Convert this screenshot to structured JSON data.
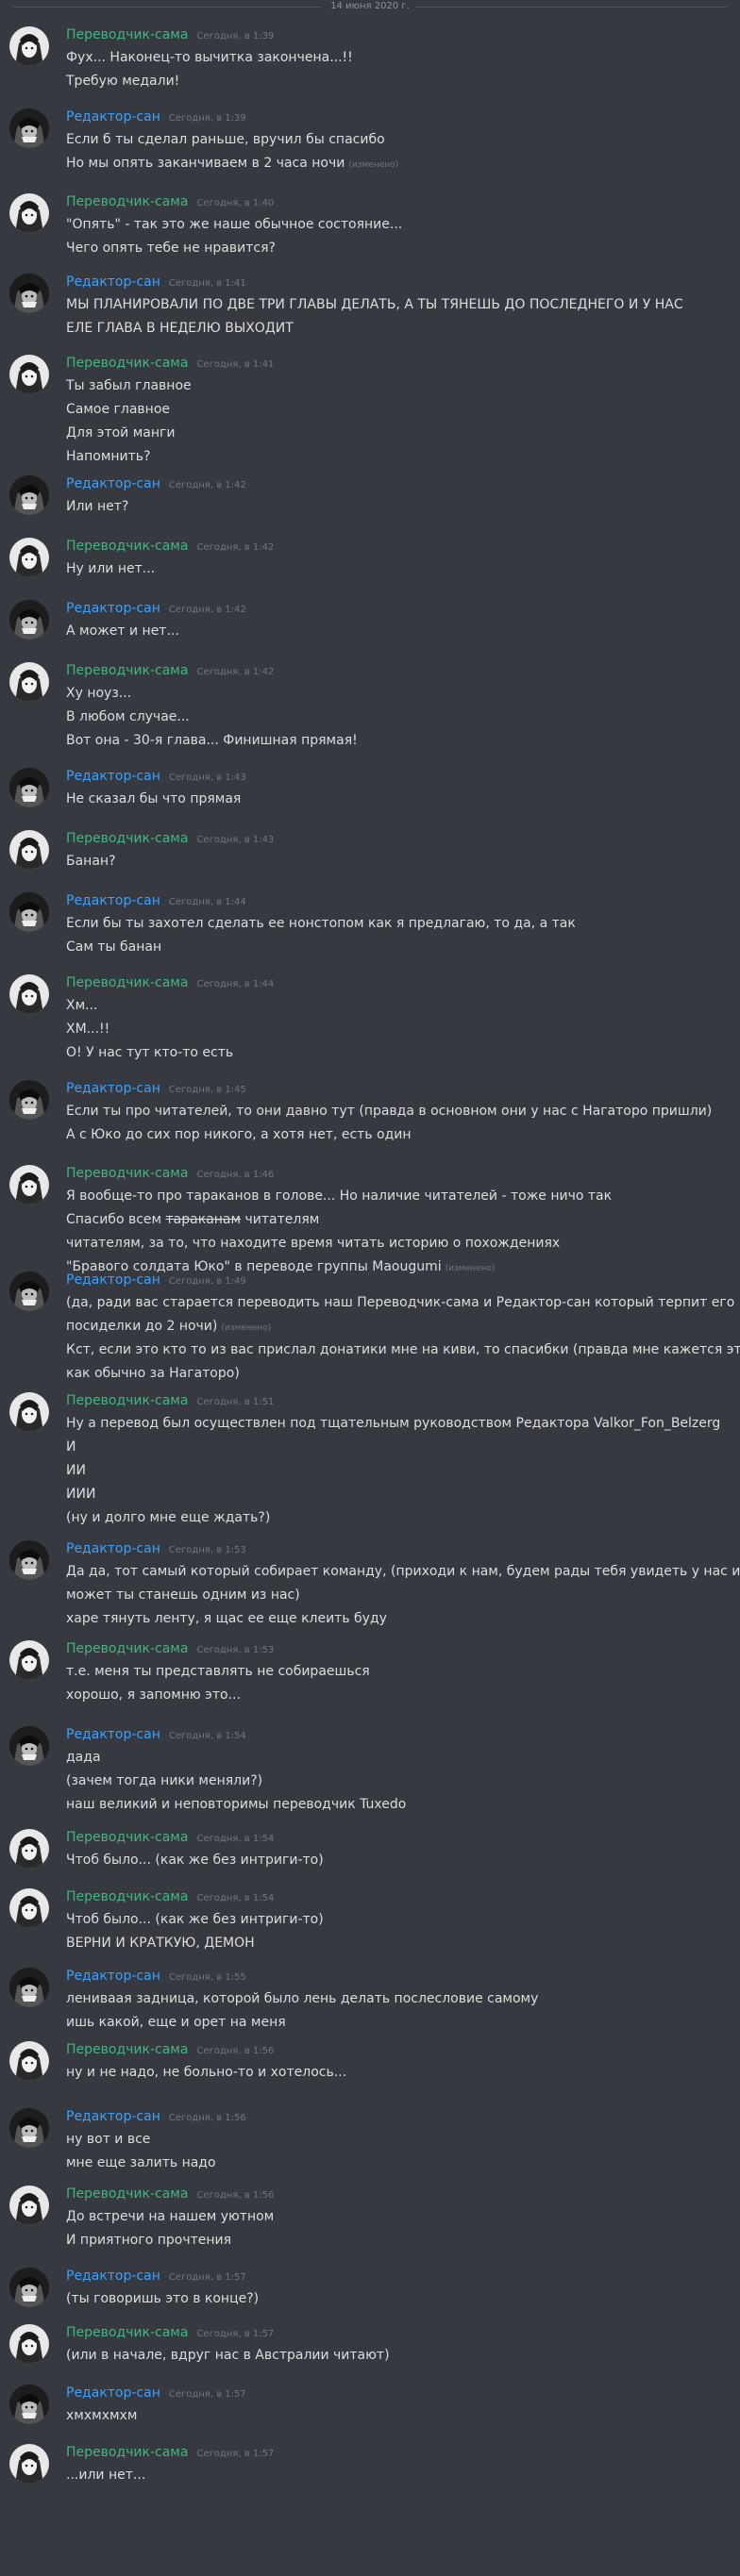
{
  "date_divider": "14 июня 2020 г.",
  "users": {
    "translator": "Переводчик-сама",
    "editor": "Редактор-сан"
  },
  "edited_label": "(изменено)",
  "messages": [
    {
      "author": "translator",
      "time": "Сегодня, в 1:39",
      "lines": [
        "Фух... Наконец-то вычитка закончена...!!",
        "Требую медали!"
      ]
    },
    {
      "author": "editor",
      "time": "Сегодня, в 1:39",
      "lines": [
        "Если б ты сделал раньше, вручил бы спасибо",
        "Но мы опять заканчиваем в 2 часа ночи"
      ],
      "edited_line": 1
    },
    {
      "author": "translator",
      "time": "Сегодня, в 1:40",
      "lines": [
        "\"Опять\" - так это же наше обычное состояние...",
        "Чего опять тебе не нравится?"
      ]
    },
    {
      "author": "editor",
      "time": "Сегодня, в 1:41",
      "lines": [
        "МЫ ПЛАНИРОВАЛИ ПО ДВЕ ТРИ ГЛАВЫ ДЕЛАТЬ, А ТЫ ТЯНЕШЬ ДО ПОСЛЕДНЕГО И У НАС",
        "ЕЛЕ ГЛАВА В НЕДЕЛЮ ВЫХОДИТ"
      ]
    },
    {
      "author": "translator",
      "time": "Сегодня, в 1:41",
      "lines": [
        "Ты забыл главное",
        "Самое главное",
        "Для этой манги",
        "Напомнить?"
      ]
    },
    {
      "author": "editor",
      "time": "Сегодня, в 1:42",
      "lines": [
        "Или нет?"
      ]
    },
    {
      "author": "translator",
      "time": "Сегодня, в 1:42",
      "lines": [
        "Ну или нет..."
      ]
    },
    {
      "author": "editor",
      "time": "Сегодня, в 1:42",
      "lines": [
        "А может и нет..."
      ]
    },
    {
      "author": "translator",
      "time": "Сегодня, в 1:42",
      "lines": [
        "Ху ноуз...",
        "В любом случае...",
        "Вот она - 30-я глава... Финишная прямая!"
      ]
    },
    {
      "author": "editor",
      "time": "Сегодня, в 1:43",
      "lines": [
        "Не сказал бы что прямая"
      ]
    },
    {
      "author": "translator",
      "time": "Сегодня, в 1:43",
      "lines": [
        "Банан?"
      ]
    },
    {
      "author": "editor",
      "time": "Сегодня, в 1:44",
      "lines": [
        "Если бы ты захотел сделать ее нонстопом как я предлагаю, то да, а так",
        "Сам ты банан"
      ]
    },
    {
      "author": "translator",
      "time": "Сегодня, в 1:44",
      "lines": [
        "Хм...",
        "ХМ...!!",
        "О! У нас тут кто-то есть"
      ]
    },
    {
      "author": "editor",
      "time": "Сегодня, в 1:45",
      "lines": [
        "Если ты про читателей, то они давно тут (правда в основном они у нас с Нагаторо пришли)",
        "А с Юко до сих пор никого, а хотя нет, есть один"
      ]
    },
    {
      "author": "translator",
      "time": "Сегодня, в 1:46",
      "lines": [
        "Я вообще-то про тараканов в голове... Но наличие читателей - тоже ничо так",
        "Спасибо всем",
        "читателям, за то, что находите время читать историю о похождениях",
        "\"Бравого солдата Юко\" в переводе группы Maougumi"
      ],
      "struck": "тараканам",
      "edited_line": 3
    },
    {
      "author": "editor",
      "time": "Сегодня, в 1:49",
      "lines": [
        "(да, ради вас старается переводить наш Переводчик-сама и Редактор-сан который терпит его",
        "посиделки до 2 ночи)",
        "Кст, если это кто то из вас прислал донатики мне на киви, то спасибки (правда мне кажется это",
        "как обычно за Нагаторо)"
      ],
      "edited_line": 1
    },
    {
      "author": "translator",
      "time": "Сегодня, в 1:51",
      "lines": [
        "Ну а перевод был осуществлен под тщательным руководством Редактора Valkor_Fon_Belzerg",
        "И",
        "ИИ",
        "ИИИ",
        "(ну и долго мне еще ждать?)"
      ]
    },
    {
      "author": "editor",
      "time": "Сегодня, в 1:53",
      "lines": [
        "Да да, тот самый который собирает команду, (приходи к нам, будем рады тебя увидеть у нас и",
        "может ты станешь одним из нас)",
        "харе тянуть ленту, я щас ее еще клеить буду"
      ]
    },
    {
      "author": "translator",
      "time": "Сегодня, в 1:53",
      "lines": [
        "т.е. меня ты представлять не собираешься",
        "хорошо, я запомню это..."
      ]
    },
    {
      "author": "editor",
      "time": "Сегодня, в 1:54",
      "lines": [
        "дада",
        "(зачем тогда ники меняли?)",
        "наш великий и неповторимы переводчик Tuxedo"
      ]
    },
    {
      "author": "translator",
      "time": "Сегодня, в 1:54",
      "lines": [
        "Чтоб было... (как же без интриги-то)"
      ]
    },
    {
      "author": "translator",
      "time": "Сегодня, в 1:54",
      "lines": [
        "Чтоб было... (как же без интриги-то)",
        "ВЕРНИ И КРАТКУЮ, ДЕМОН"
      ]
    },
    {
      "author": "editor",
      "time": "Сегодня, в 1:55",
      "lines": [
        "лениваая задница, которой было лень делать послесловие самому",
        "ишь какой, еще и орет на меня"
      ]
    },
    {
      "author": "translator",
      "time": "Сегодня, в 1:56",
      "lines": [
        "ну и не надо, не больно-то и хотелось..."
      ]
    },
    {
      "author": "editor",
      "time": "Сегодня, в 1:56",
      "lines": [
        "ну вот и все",
        "мне еще залить надо"
      ]
    },
    {
      "author": "translator",
      "time": "Сегодня, в 1:56",
      "lines": [
        "До встречи на нашем уютном",
        "И приятного прочтения"
      ]
    },
    {
      "author": "editor",
      "time": "Сегодня, в 1:57",
      "lines": [
        "(ты говоришь это в конце?)"
      ]
    },
    {
      "author": "translator",
      "time": "Сегодня, в 1:57",
      "lines": [
        "(или в начале, вдруг нас в Австралии читают)"
      ]
    },
    {
      "author": "editor",
      "time": "Сегодня, в 1:57",
      "lines": [
        "хмхмхмхм"
      ]
    },
    {
      "author": "translator",
      "time": "Сегодня, в 1:57",
      "lines": [
        "...или нет..."
      ]
    }
  ]
}
